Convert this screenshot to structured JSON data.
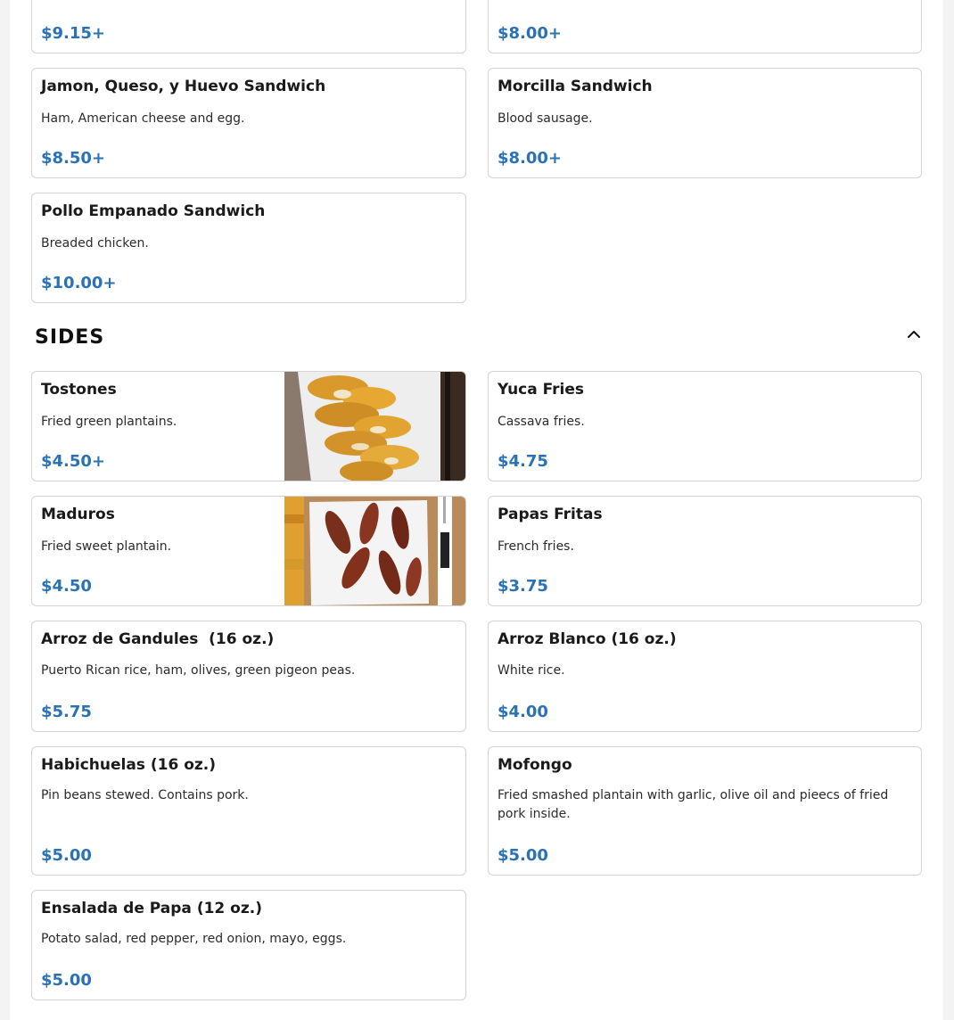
{
  "top_items": [
    {
      "price": "$9.15+"
    },
    {
      "price": "$8.00+"
    },
    {
      "name": "Jamon, Queso, y Huevo Sandwich",
      "description": "Ham, American cheese and egg.",
      "price": "$8.50+"
    },
    {
      "name": "Morcilla Sandwich",
      "description": "Blood sausage.",
      "price": "$8.00+"
    },
    {
      "name": "Pollo Empanado Sandwich",
      "description": "Breaded chicken.",
      "price": "$10.00+"
    }
  ],
  "sides": {
    "title": "SIDES",
    "items": [
      {
        "name": "Tostones",
        "description": "Fried green plantains.",
        "price": "$4.50+"
      },
      {
        "name": "Yuca Fries",
        "description": "Cassava fries.",
        "price": "$4.75"
      },
      {
        "name": "Maduros",
        "description": "Fried sweet plantain.",
        "price": "$4.50"
      },
      {
        "name": "Papas Fritas",
        "description": "French fries.",
        "price": "$3.75"
      },
      {
        "name": "Arroz de Gandules  (16 oz.)",
        "description": "Puerto Rican rice, ham, olives, green pigeon peas.",
        "price": "$5.75"
      },
      {
        "name": "Arroz Blanco (16 oz.)",
        "description": "White rice.",
        "price": "$4.00"
      },
      {
        "name": "Habichuelas (16 oz.)",
        "description": "Pin beans stewed. Contains pork.",
        "price": "$5.00"
      },
      {
        "name": "Mofongo",
        "description": "Fried smashed plantain with garlic, olive oil and pieecs of fried pork inside.",
        "price": "$5.00"
      },
      {
        "name": "Ensalada de Papa (12 oz.)",
        "description": "Potato salad, red pepper, red onion, mayo, eggs.",
        "price": "$5.00"
      }
    ]
  },
  "icons": {
    "collapse": "chevron-up-icon"
  },
  "colors": {
    "price": "#2a72b5",
    "border": "#d4d4d4",
    "background": "#ffffff"
  }
}
